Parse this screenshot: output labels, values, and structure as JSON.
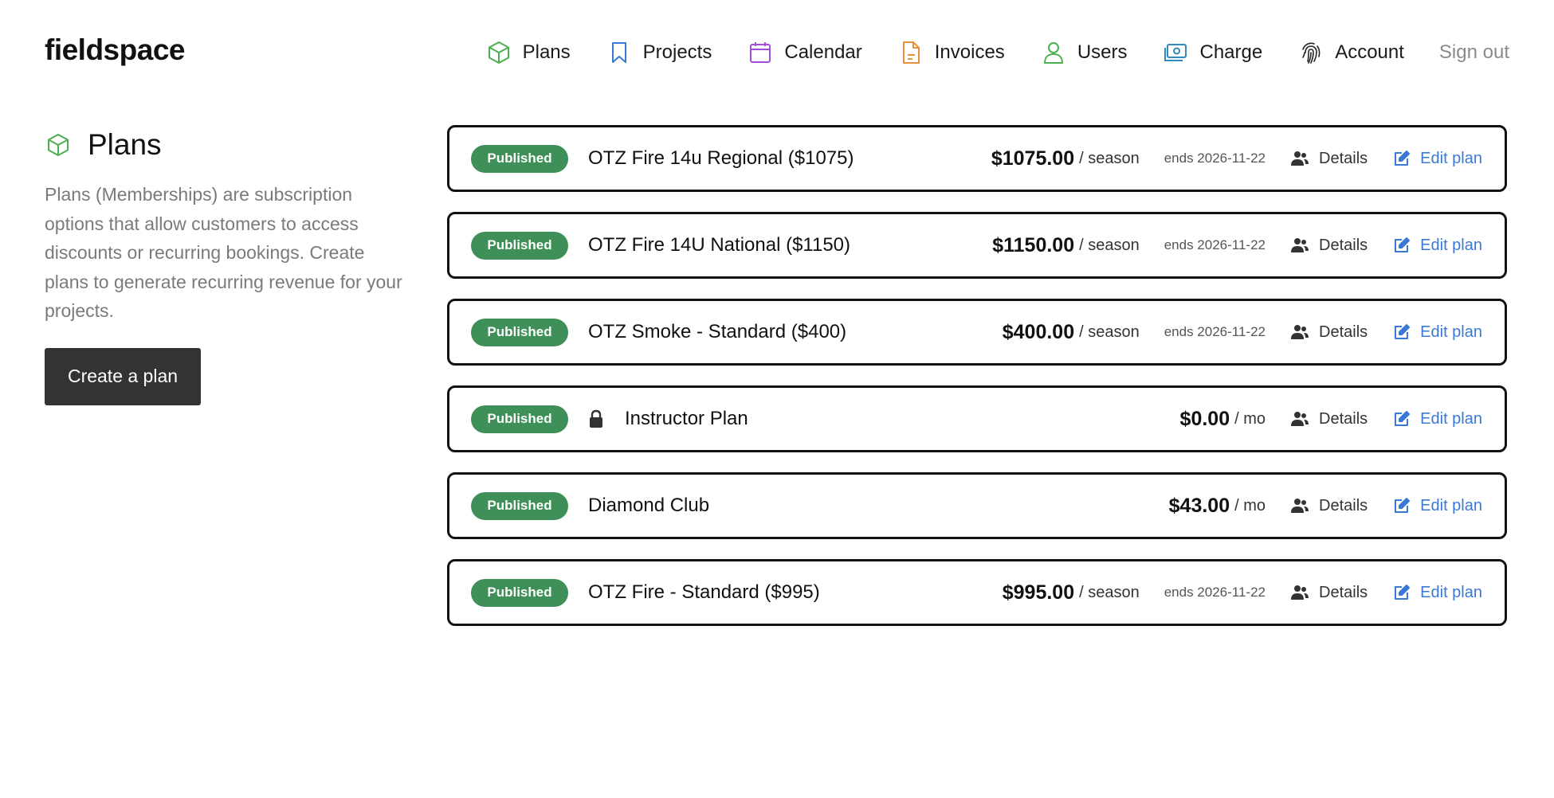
{
  "header": {
    "logo": "fieldspace",
    "nav": [
      {
        "label": "Plans",
        "icon": "cube-icon",
        "color": "#4caf50"
      },
      {
        "label": "Projects",
        "icon": "bookmark-icon",
        "color": "#3a78d6"
      },
      {
        "label": "Calendar",
        "icon": "calendar-icon",
        "color": "#a24fd8"
      },
      {
        "label": "Invoices",
        "icon": "document-icon",
        "color": "#e8913a"
      },
      {
        "label": "Users",
        "icon": "user-icon",
        "color": "#4caf50"
      },
      {
        "label": "Charge",
        "icon": "money-icon",
        "color": "#2e8bc0"
      },
      {
        "label": "Account",
        "icon": "fingerprint-icon",
        "color": "#222222"
      }
    ],
    "sign_out": "Sign out"
  },
  "sidebar": {
    "title": "Plans",
    "description": "Plans (Memberships) are subscription options that allow customers to access discounts or recurring bookings. Create plans to generate recurring revenue for your projects.",
    "create_button": "Create a plan"
  },
  "plans": [
    {
      "status": "Published",
      "name": "OTZ Fire 14u Regional ($1075)",
      "price": "$1075.00",
      "period": "/ season",
      "ends": "ends 2026-11-22",
      "locked": false,
      "details": "Details",
      "edit": "Edit plan"
    },
    {
      "status": "Published",
      "name": "OTZ Fire 14U National ($1150)",
      "price": "$1150.00",
      "period": "/ season",
      "ends": "ends 2026-11-22",
      "locked": false,
      "details": "Details",
      "edit": "Edit plan"
    },
    {
      "status": "Published",
      "name": "OTZ Smoke - Standard ($400)",
      "price": "$400.00",
      "period": "/ season",
      "ends": "ends 2026-11-22",
      "locked": false,
      "details": "Details",
      "edit": "Edit plan"
    },
    {
      "status": "Published",
      "name": "Instructor Plan",
      "price": "$0.00",
      "period": "/ mo",
      "ends": "",
      "locked": true,
      "details": "Details",
      "edit": "Edit plan"
    },
    {
      "status": "Published",
      "name": "Diamond Club",
      "price": "$43.00",
      "period": "/ mo",
      "ends": "",
      "locked": false,
      "details": "Details",
      "edit": "Edit plan"
    },
    {
      "status": "Published",
      "name": "OTZ Fire - Standard ($995)",
      "price": "$995.00",
      "period": "/ season",
      "ends": "ends 2026-11-22",
      "locked": false,
      "details": "Details",
      "edit": "Edit plan"
    }
  ],
  "colors": {
    "badge": "#3f8f58",
    "link": "#3a78d6",
    "button": "#333333"
  }
}
